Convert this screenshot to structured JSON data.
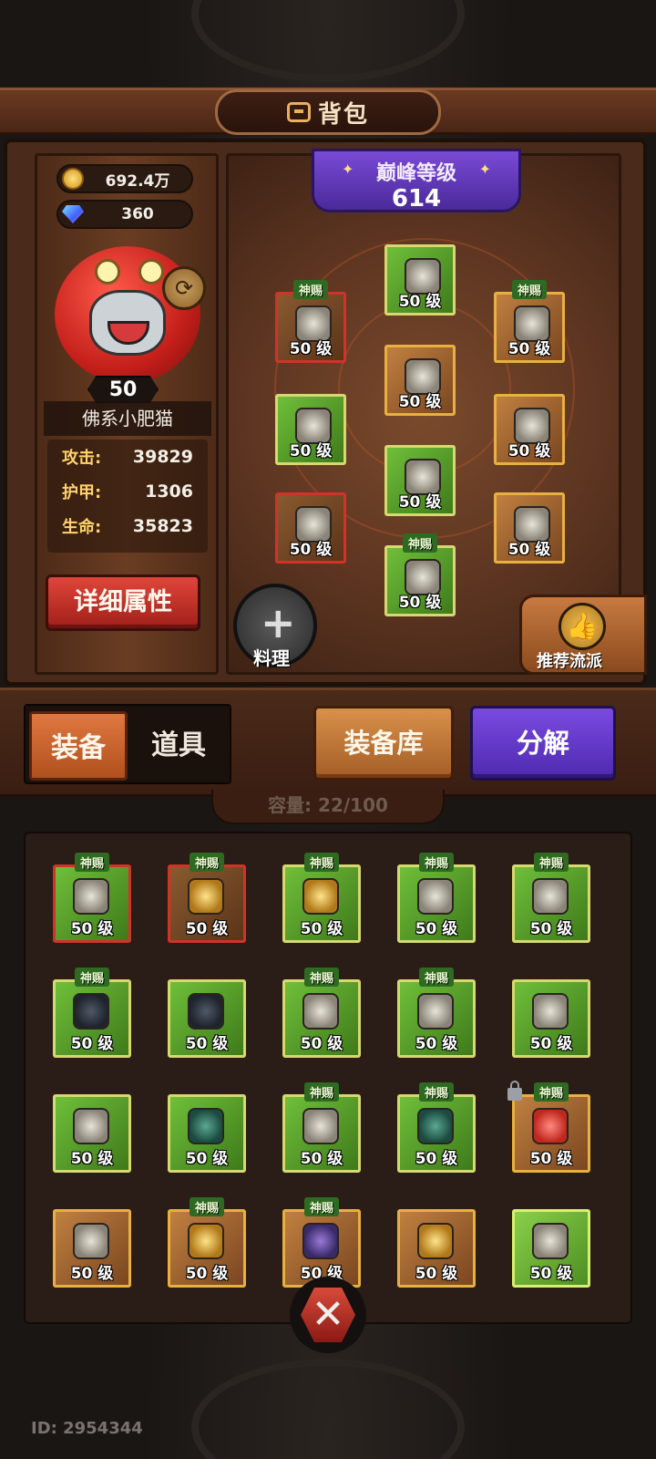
{
  "header": {
    "title": "背包"
  },
  "currency": {
    "gold": "692.4万",
    "gems": "360"
  },
  "player": {
    "level": "50",
    "name": "佛系小肥猫",
    "stats": [
      {
        "label": "攻击:",
        "value": "39829"
      },
      {
        "label": "护甲:",
        "value": "1306"
      },
      {
        "label": "生命:",
        "value": "35823"
      }
    ],
    "detail_button": "详细属性"
  },
  "peak": {
    "title": "巅峰等级",
    "value": "614"
  },
  "equipped": {
    "tag": "神赐",
    "level_label": "50 级",
    "slots": [
      {
        "id": "helmet",
        "color": "green",
        "tagged": false
      },
      {
        "id": "shoulder",
        "color": "red",
        "tagged": true
      },
      {
        "id": "necklace",
        "color": "orange",
        "tagged": true
      },
      {
        "id": "chest",
        "color": "orange",
        "tagged": false
      },
      {
        "id": "gloves",
        "color": "green",
        "tagged": false
      },
      {
        "id": "ring",
        "color": "orange",
        "tagged": false
      },
      {
        "id": "pants",
        "color": "green",
        "tagged": false
      },
      {
        "id": "weapon",
        "color": "red",
        "tagged": false
      },
      {
        "id": "accessory",
        "color": "orange",
        "tagged": false
      },
      {
        "id": "boots",
        "color": "green",
        "tagged": true
      }
    ]
  },
  "cook_button": "料理",
  "recommend_button": "推荐流派",
  "tabs": {
    "equipment": "装备",
    "items": "道具"
  },
  "warehouse_button": "装备库",
  "decompose_button": "分解",
  "capacity": "容量: 22/100",
  "inventory": {
    "tag": "神赐",
    "level_label": "50 级",
    "rows": [
      [
        {
          "color": "lime-red",
          "tagged": true,
          "item": "light"
        },
        {
          "color": "red",
          "tagged": true,
          "item": "gold"
        },
        {
          "color": "green",
          "tagged": true,
          "item": "gold"
        },
        {
          "color": "green",
          "tagged": true,
          "item": "light"
        },
        {
          "color": "green",
          "tagged": true,
          "item": "light"
        }
      ],
      [
        {
          "color": "green",
          "tagged": true,
          "item": "dark"
        },
        {
          "color": "green",
          "tagged": false,
          "item": "dark"
        },
        {
          "color": "green",
          "tagged": true,
          "item": "light"
        },
        {
          "color": "green",
          "tagged": true,
          "item": "light"
        },
        {
          "color": "green",
          "tagged": false,
          "item": "light"
        }
      ],
      [
        {
          "color": "green",
          "tagged": false,
          "item": "light"
        },
        {
          "color": "green",
          "tagged": false,
          "item": "teal"
        },
        {
          "color": "green",
          "tagged": true,
          "item": "light"
        },
        {
          "color": "green",
          "tagged": true,
          "item": "teal"
        },
        {
          "color": "orange",
          "tagged": true,
          "item": "stop",
          "locked": true
        }
      ],
      [
        {
          "color": "orange",
          "tagged": false,
          "item": "light"
        },
        {
          "color": "orange",
          "tagged": true,
          "item": "gold"
        },
        {
          "color": "orange",
          "tagged": true,
          "item": "purple"
        },
        {
          "color": "orange",
          "tagged": false,
          "item": "gold"
        },
        {
          "color": "lime",
          "tagged": false,
          "item": "light"
        }
      ]
    ]
  },
  "player_id": "ID: 2954344"
}
